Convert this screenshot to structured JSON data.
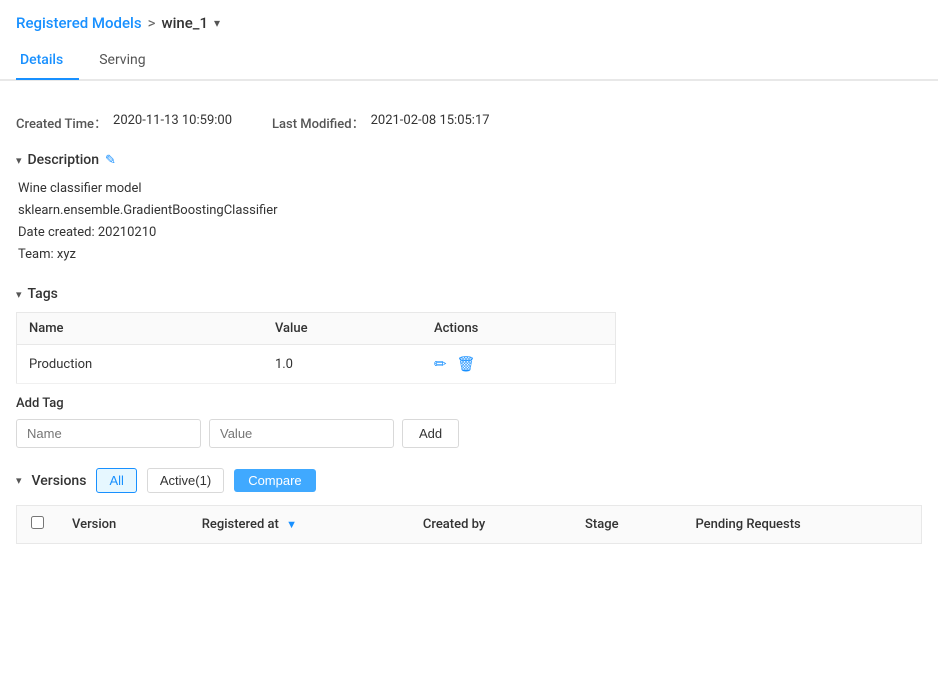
{
  "breadcrumb": {
    "parent_label": "Registered Models",
    "separator": ">",
    "current_label": "wine_1",
    "dropdown_arrow": "▾"
  },
  "tabs": [
    {
      "id": "details",
      "label": "Details",
      "active": true
    },
    {
      "id": "serving",
      "label": "Serving",
      "active": false
    }
  ],
  "meta": {
    "created_label": "Created Time：",
    "created_value": "2020-11-13 10:59:00",
    "modified_label": "Last Modified：",
    "modified_value": "2021-02-08 15:05:17"
  },
  "description": {
    "section_title": "Description",
    "edit_icon": "✎",
    "toggle_icon": "▾",
    "lines": [
      "Wine classifier model",
      "sklearn.ensemble.GradientBoostingClassifier",
      "Date created: 20210210",
      "Team: xyz"
    ]
  },
  "tags": {
    "section_title": "Tags",
    "toggle_icon": "▾",
    "table_headers": [
      "Name",
      "Value",
      "Actions"
    ],
    "rows": [
      {
        "name": "Production",
        "value": "1.0"
      }
    ],
    "add_tag_label": "Add Tag",
    "name_placeholder": "Name",
    "value_placeholder": "Value",
    "add_button": "Add"
  },
  "versions": {
    "section_title": "Versions",
    "toggle_icon": "▾",
    "filter_all": "All",
    "filter_active": "Active(1)",
    "compare_button": "Compare",
    "table_headers": [
      "",
      "Version",
      "Registered at",
      "Created by",
      "Stage",
      "Pending Requests"
    ]
  },
  "icons": {
    "edit": "✎",
    "delete": "🗑",
    "pencil": "✏"
  }
}
